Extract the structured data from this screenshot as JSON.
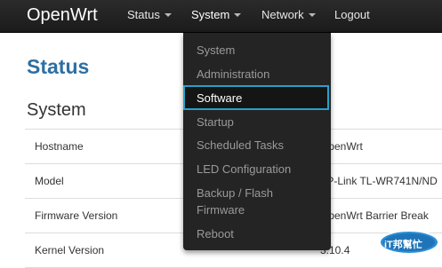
{
  "navbar": {
    "brand": "OpenWrt",
    "items": [
      {
        "label": "Status",
        "has_caret": true
      },
      {
        "label": "System",
        "has_caret": true
      },
      {
        "label": "Network",
        "has_caret": true
      },
      {
        "label": "Logout",
        "has_caret": false
      }
    ]
  },
  "page": {
    "title": "Status",
    "section": "System"
  },
  "table": {
    "rows": [
      {
        "label": "Hostname",
        "value": "OpenWrt"
      },
      {
        "label": "Model",
        "value": "TP-Link TL-WR741N/ND"
      },
      {
        "label": "Firmware Version",
        "value": "OpenWrt Barrier Break"
      },
      {
        "label": "Kernel Version",
        "value": "3.10.4"
      }
    ]
  },
  "dropdown": {
    "items": [
      "System",
      "Administration",
      "Software",
      "Startup",
      "Scheduled Tasks",
      "LED Configuration",
      "Backup / Flash Firmware",
      "Reboot"
    ],
    "selected": "Software"
  },
  "watermark": {
    "text": "iT邦幫忙"
  },
  "colors": {
    "navbar_bg": "#1b1b1b",
    "title_blue": "#2e6fa3",
    "highlight_border": "#2aa0c8",
    "dropdown_bg": "#242424"
  }
}
